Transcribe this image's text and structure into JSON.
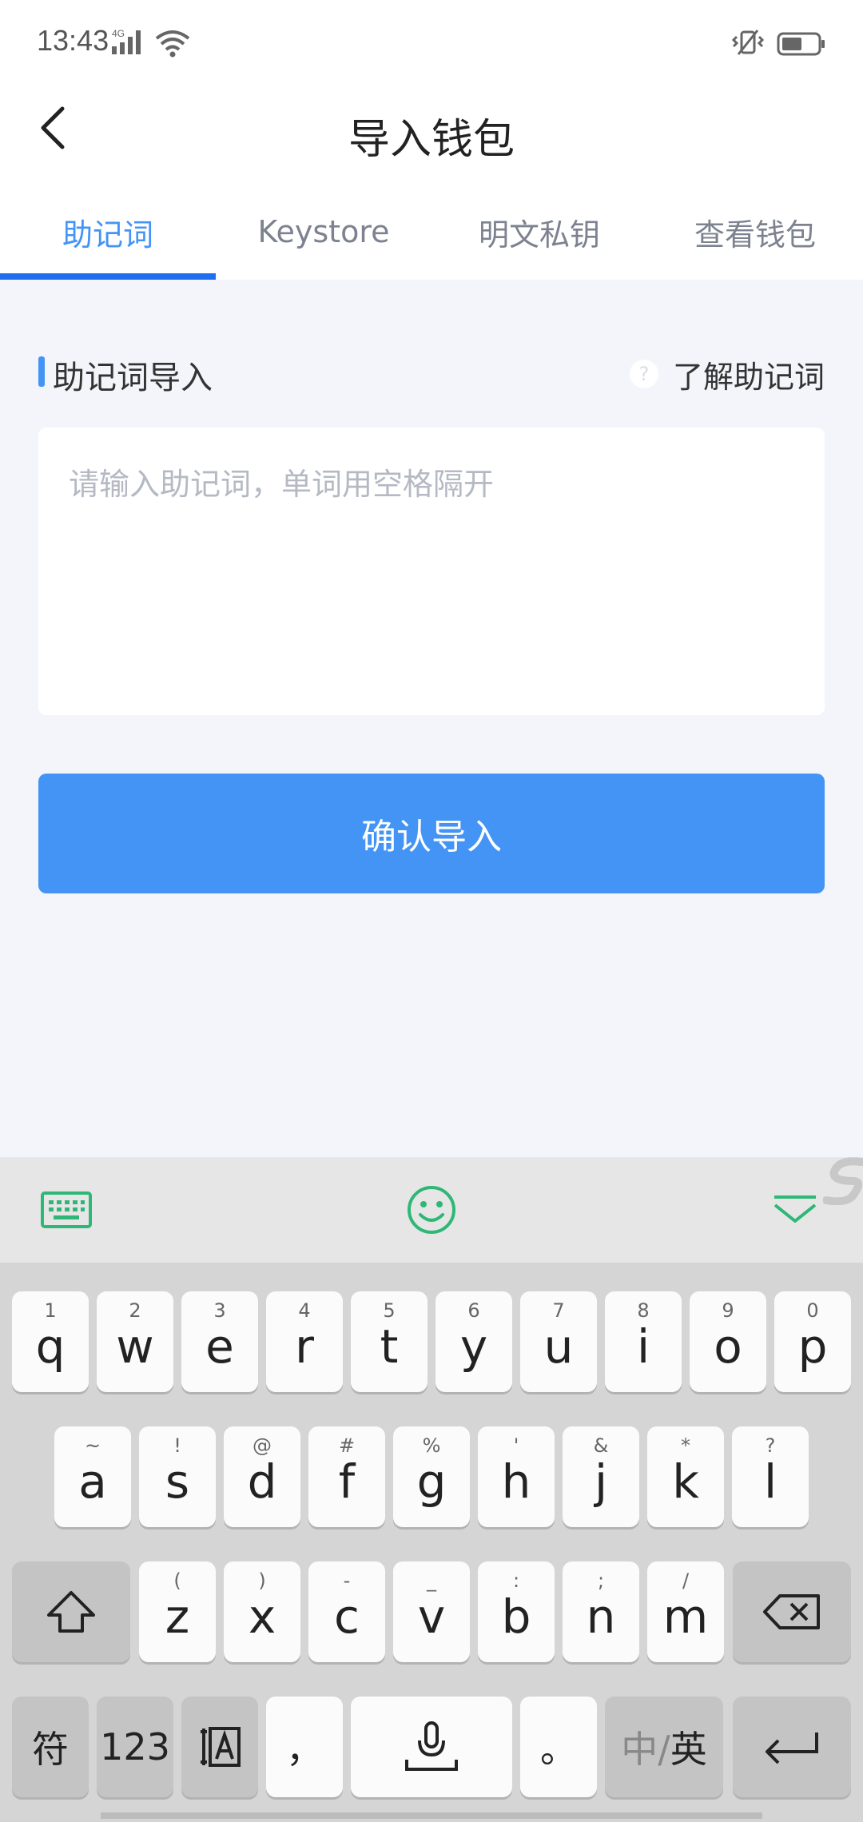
{
  "status_bar": {
    "time": "13:43",
    "network": "4G"
  },
  "header": {
    "title": "导入钱包"
  },
  "tabs": [
    {
      "label": "助记词",
      "active": true
    },
    {
      "label": "Keystore",
      "active": false
    },
    {
      "label": "明文私钥",
      "active": false
    },
    {
      "label": "查看钱包",
      "active": false
    }
  ],
  "section": {
    "title": "助记词导入",
    "help_label": "了解助记词",
    "help_icon": "question-circle-icon"
  },
  "mnemonic": {
    "value": "",
    "placeholder": "请输入助记词，单词用空格隔开"
  },
  "confirm": {
    "label": "确认导入"
  },
  "keyboard": {
    "rows": [
      [
        {
          "key": "q",
          "hint": "1"
        },
        {
          "key": "w",
          "hint": "2"
        },
        {
          "key": "e",
          "hint": "3"
        },
        {
          "key": "r",
          "hint": "4"
        },
        {
          "key": "t",
          "hint": "5"
        },
        {
          "key": "y",
          "hint": "6"
        },
        {
          "key": "u",
          "hint": "7"
        },
        {
          "key": "i",
          "hint": "8"
        },
        {
          "key": "o",
          "hint": "9"
        },
        {
          "key": "p",
          "hint": "0"
        }
      ],
      [
        {
          "key": "a",
          "hint": "~"
        },
        {
          "key": "s",
          "hint": "!"
        },
        {
          "key": "d",
          "hint": "@"
        },
        {
          "key": "f",
          "hint": "#"
        },
        {
          "key": "g",
          "hint": "%"
        },
        {
          "key": "h",
          "hint": "'"
        },
        {
          "key": "j",
          "hint": "&"
        },
        {
          "key": "k",
          "hint": "*"
        },
        {
          "key": "l",
          "hint": "?"
        }
      ],
      [
        {
          "key": "z",
          "hint": "("
        },
        {
          "key": "x",
          "hint": ")"
        },
        {
          "key": "c",
          "hint": "-"
        },
        {
          "key": "v",
          "hint": "_"
        },
        {
          "key": "b",
          "hint": ":"
        },
        {
          "key": "n",
          "hint": ";"
        },
        {
          "key": "m",
          "hint": "/"
        }
      ]
    ],
    "symbols_label": "符",
    "numbers_label": "123",
    "comma_label": "，",
    "period_label": "。",
    "lang_label_zh": "中",
    "lang_label_sep": "/",
    "lang_label_en": "英",
    "accent_color": "#2fb777"
  }
}
